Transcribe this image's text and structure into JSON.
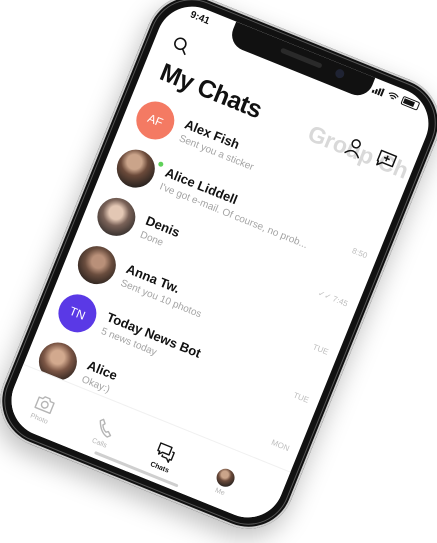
{
  "status": {
    "time": "9:41"
  },
  "header": {
    "title": "My Chats",
    "next_tab_title": "Group Ch"
  },
  "colors": {
    "accent_orange": "#f47a63",
    "accent_purple": "#5a39e6",
    "online": "#5fd15a"
  },
  "chats": [
    {
      "initials": "AF",
      "avatar_color": "#f47a63",
      "name": "Alex Fish",
      "preview": "Sent you a sticker",
      "time": ""
    },
    {
      "initials": "",
      "name": "Alice Liddell",
      "preview": "I've got e-mail. Of course, no prob...",
      "time": "8:50",
      "online": true
    },
    {
      "initials": "",
      "name": "Denis",
      "preview": "Done",
      "time": "7:45"
    },
    {
      "initials": "",
      "name": "Anna Tw.",
      "preview": "Sent you 10 photos",
      "time": "TUE"
    },
    {
      "initials": "TN",
      "avatar_color": "#5a39e6",
      "name": "Today News Bot",
      "preview": "5 news today",
      "time": "TUE"
    },
    {
      "initials": "",
      "name": "Alice",
      "preview": "Okay:)",
      "time": "MON"
    }
  ],
  "tabbar": {
    "photo": "Photo",
    "calls": "Calls",
    "chats": "Chats",
    "me": "Me"
  }
}
